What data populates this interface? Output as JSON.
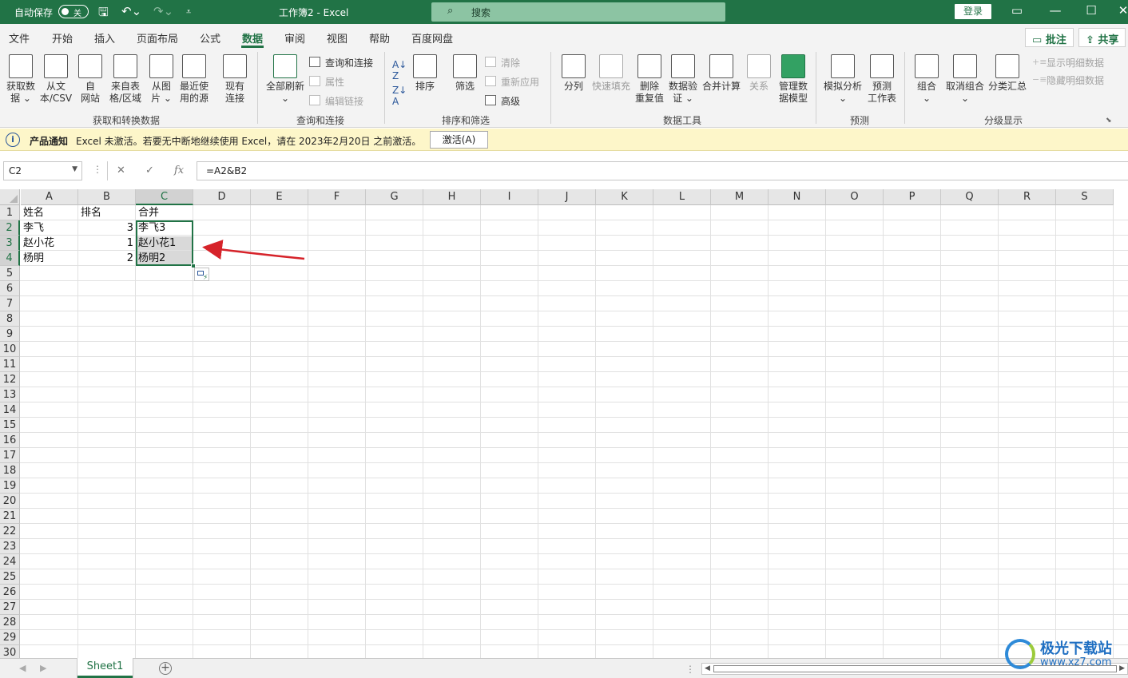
{
  "titlebar": {
    "autosave_label": "自动保存",
    "autosave_state": "关",
    "doc_title": "工作簿2  -  Excel",
    "search_placeholder": "搜索",
    "login_label": "登录",
    "accent": "#217346"
  },
  "tabs": [
    {
      "label": "文件",
      "active": false
    },
    {
      "label": "开始",
      "active": false
    },
    {
      "label": "插入",
      "active": false
    },
    {
      "label": "页面布局",
      "active": false
    },
    {
      "label": "公式",
      "active": false
    },
    {
      "label": "数据",
      "active": true
    },
    {
      "label": "审阅",
      "active": false
    },
    {
      "label": "视图",
      "active": false
    },
    {
      "label": "帮助",
      "active": false
    },
    {
      "label": "百度网盘",
      "active": false
    }
  ],
  "topright": {
    "comment_label": "批注",
    "share_label": "共享"
  },
  "ribbon": {
    "get_data": {
      "l1": "获取数",
      "l2": "据 ⌄"
    },
    "from_text": {
      "l1": "从文",
      "l2": "本/CSV"
    },
    "from_web": {
      "l1": "自",
      "l2": "网站"
    },
    "from_table": {
      "l1": "来自表",
      "l2": "格/区域"
    },
    "from_picture": {
      "l1": "从图",
      "l2": "片 ⌄"
    },
    "recent_sources": {
      "l1": "最近使",
      "l2": "用的源"
    },
    "existing_conn": {
      "l1": "现有",
      "l2": "连接"
    },
    "group_get": "获取和转换数据",
    "refresh_all": {
      "l1": "全部刷新",
      "l2": "⌄"
    },
    "queries_conn": "查询和连接",
    "properties": "属性",
    "edit_links": "编辑链接",
    "group_queries": "查询和连接",
    "sort_label": "排序",
    "filter_label": "筛选",
    "clear": "清除",
    "reapply": "重新应用",
    "advanced": "高级",
    "group_sort": "排序和筛选",
    "text_to_cols": "分列",
    "flash_fill": "快速填充",
    "remove_dup": {
      "l1": "删除",
      "l2": "重复值"
    },
    "data_valid": {
      "l1": "数据验",
      "l2": "证 ⌄"
    },
    "consolidate": "合并计算",
    "relations": "关系",
    "data_model": {
      "l1": "管理数",
      "l2": "据模型"
    },
    "group_tools": "数据工具",
    "what_if": {
      "l1": "模拟分析",
      "l2": "⌄"
    },
    "forecast": {
      "l1": "预测",
      "l2": "工作表"
    },
    "group_forecast": "预测",
    "group_btn": {
      "l1": "组合",
      "l2": "⌄"
    },
    "ungroup_btn": {
      "l1": "取消组合",
      "l2": "⌄"
    },
    "subtotal": "分类汇总",
    "show_detail": "显示明细数据",
    "hide_detail": "隐藏明细数据",
    "group_outline": "分级显示"
  },
  "notice": {
    "title": "产品通知",
    "message": "Excel 未激活。若要无中断地继续使用 Excel，请在 2023年2月20日 之前激活。",
    "button": "激活(A)"
  },
  "formula_bar": {
    "name_box": "C2",
    "fx": "fx",
    "formula": "=A2&B2"
  },
  "grid": {
    "columns": [
      "A",
      "B",
      "C",
      "D",
      "E",
      "F",
      "G",
      "H",
      "I",
      "J",
      "K",
      "L",
      "M",
      "N",
      "O",
      "P",
      "Q",
      "R",
      "S"
    ],
    "rows": [
      "1",
      "2",
      "3",
      "4",
      "5",
      "6",
      "7",
      "8",
      "9",
      "10",
      "11",
      "12",
      "13",
      "14",
      "15",
      "16",
      "17",
      "18",
      "19",
      "20",
      "21",
      "22",
      "23",
      "24",
      "25",
      "26",
      "27",
      "28",
      "29",
      "30"
    ],
    "cells": {
      "A1": "姓名",
      "B1": "排名",
      "C1": "合并",
      "A2": "李飞",
      "B2": "3",
      "C2": "李飞3",
      "A3": "赵小花",
      "B3": "1",
      "C3": "赵小花1",
      "A4": "杨明",
      "B4": "2",
      "C4": "杨明2"
    }
  },
  "sheets": {
    "active": "Sheet1"
  },
  "watermark": {
    "t1": "极光下载站",
    "t2": "www.xz7.com"
  }
}
